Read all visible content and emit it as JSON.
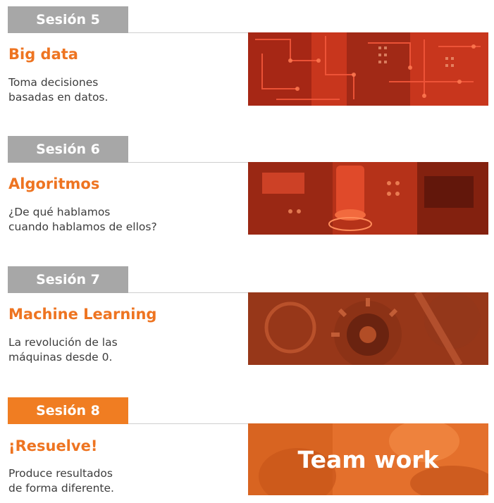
{
  "colors": {
    "accent": "#ee7421",
    "badge_gray": "#a7a7a7",
    "badge_orange": "#f07d22",
    "text": "#3d3d3d"
  },
  "sessions": [
    {
      "badge": "Sesión 5",
      "title": "Big data",
      "description": [
        "Toma decisiones",
        "basadas en datos."
      ],
      "image": "circuit-board-image"
    },
    {
      "badge": "Sesión 6",
      "title": "Algoritmos",
      "description": [
        "¿De qué hablamos",
        "cuando hablamos de ellos?"
      ],
      "image": "electronic-components-image"
    },
    {
      "badge": "Sesión 7",
      "title": "Machine Learning",
      "description": [
        "La revolución de las",
        "máquinas desde 0."
      ],
      "image": "gears-machinery-image"
    },
    {
      "badge": "Sesión 8",
      "title": "¡Resuelve!",
      "description": [
        "Produce resultados",
        "de forma diferente."
      ],
      "image": "team-work-image",
      "image_caption": "Team work"
    }
  ]
}
